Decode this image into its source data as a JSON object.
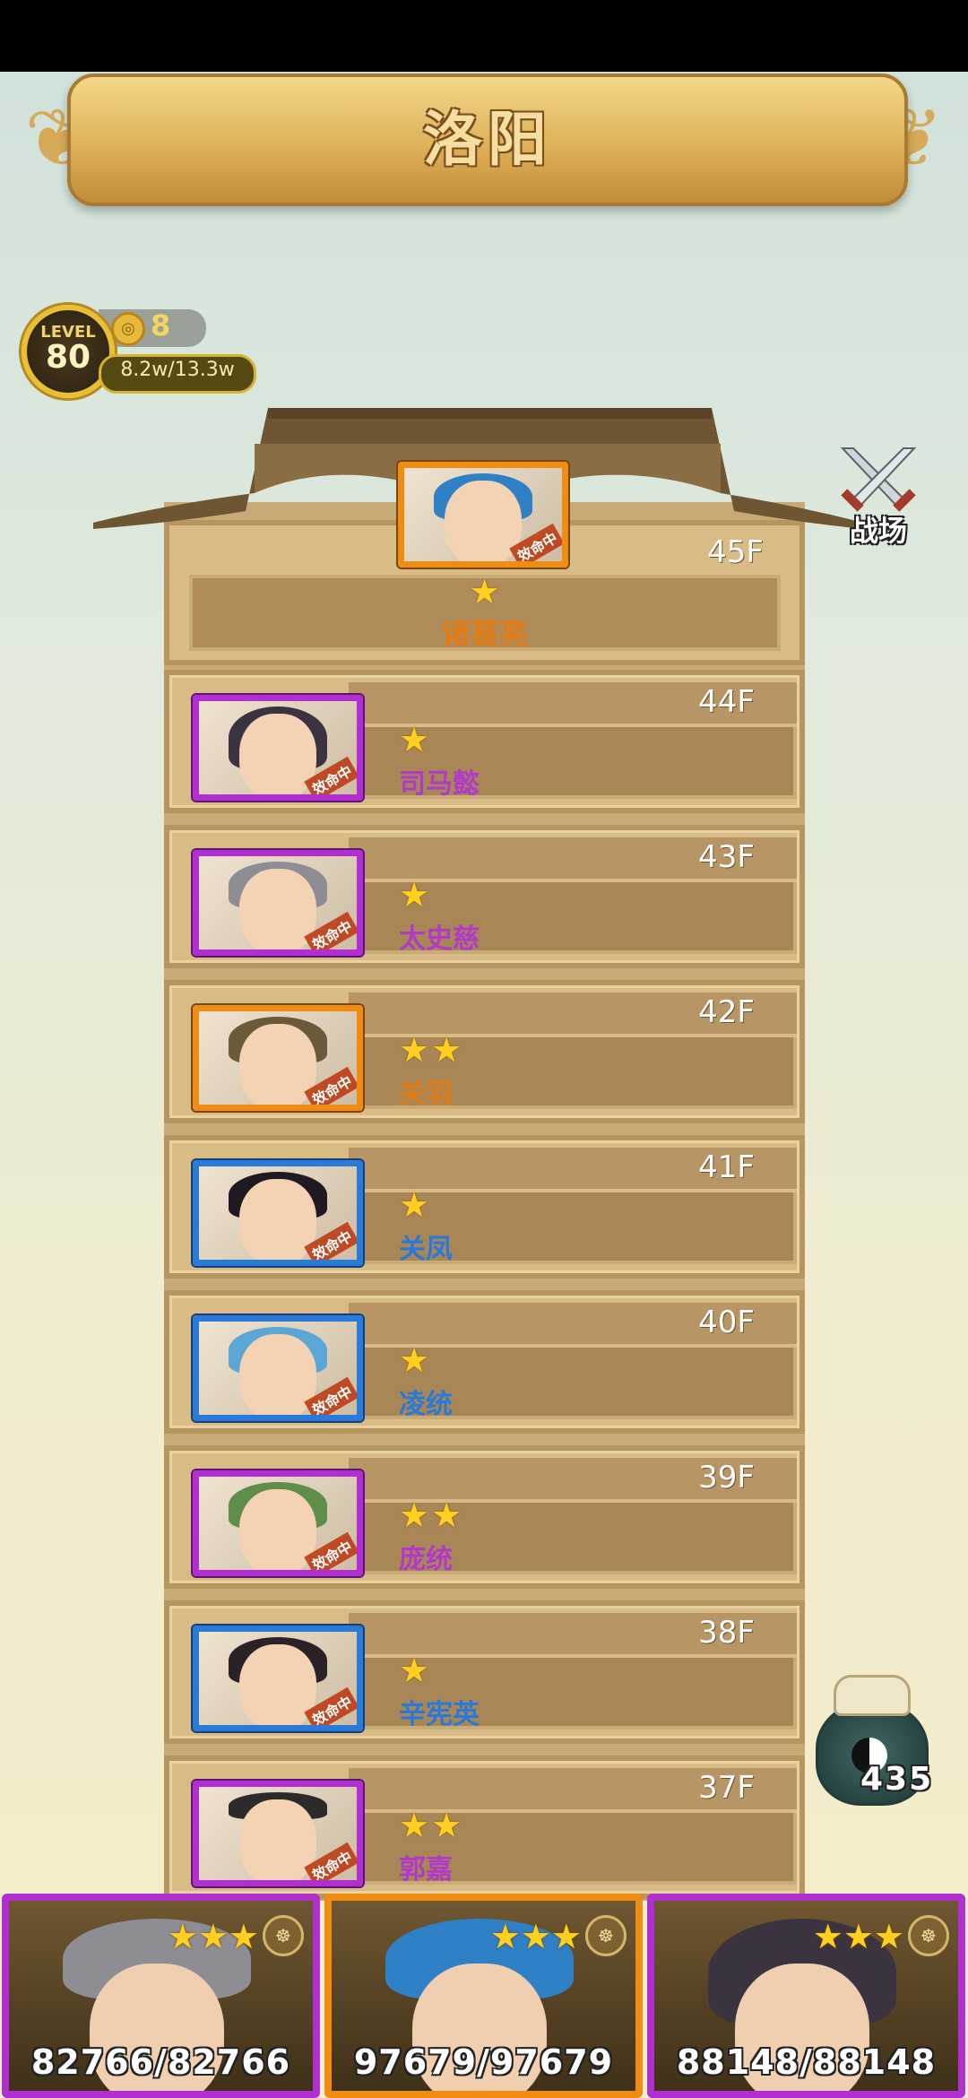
{
  "header": {
    "title": "洛阳"
  },
  "player": {
    "level_word": "LEVEL",
    "level": "80",
    "coins": "8",
    "exp": "8.2w/13.3w"
  },
  "side": {
    "battle_label": "战场",
    "jar_count": "435"
  },
  "top_floor": {
    "floor": "45F",
    "stars": "★",
    "name": "诸葛亮",
    "tag": "效命中",
    "rarity": "orange"
  },
  "floors": [
    {
      "floor": "44F",
      "stars": "★",
      "name": "司马懿",
      "tag": "效命中",
      "rarity": "purple"
    },
    {
      "floor": "43F",
      "stars": "★",
      "name": "太史慈",
      "tag": "效命中",
      "rarity": "purple"
    },
    {
      "floor": "42F",
      "stars": "★★",
      "name": "关羽",
      "tag": "效命中",
      "rarity": "orange"
    },
    {
      "floor": "41F",
      "stars": "★",
      "name": "关凤",
      "tag": "效命中",
      "rarity": "blue"
    },
    {
      "floor": "40F",
      "stars": "★",
      "name": "凌统",
      "tag": "效命中",
      "rarity": "blue"
    },
    {
      "floor": "39F",
      "stars": "★★",
      "name": "庞统",
      "tag": "效命中",
      "rarity": "purple"
    },
    {
      "floor": "38F",
      "stars": "★",
      "name": "辛宪英",
      "tag": "效命中",
      "rarity": "blue"
    },
    {
      "floor": "37F",
      "stars": "★★",
      "name": "郭嘉",
      "tag": "效命中",
      "rarity": "purple"
    }
  ],
  "team": [
    {
      "stars": "★★★",
      "hp": "82766/82766",
      "rarity": "purple"
    },
    {
      "stars": "★★★",
      "hp": "97679/97679",
      "rarity": "orange"
    },
    {
      "stars": "★★★",
      "hp": "88148/88148",
      "rarity": "purple"
    }
  ],
  "colors": {
    "purple": "#b12fd1",
    "orange": "#ef8d12",
    "blue": "#2a7ad7",
    "gold": "#ffd020"
  }
}
